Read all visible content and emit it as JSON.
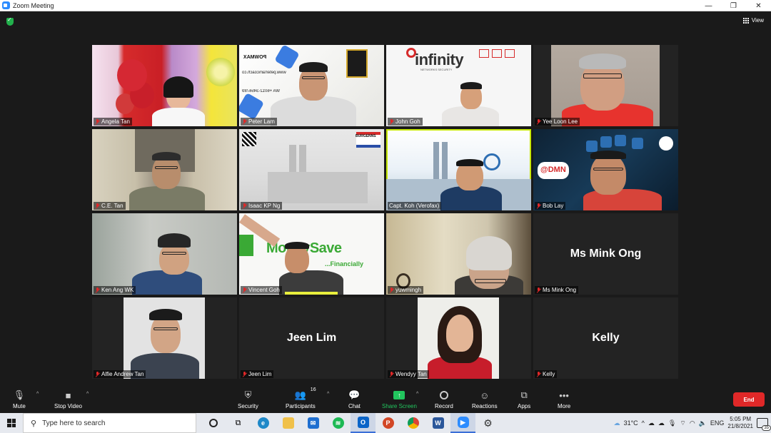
{
  "window": {
    "title": "Zoom Meeting",
    "minimize": "—",
    "maximize": "❐",
    "close": "✕"
  },
  "topbar": {
    "view_label": "View"
  },
  "tiles": [
    {
      "name": "Angela Tan"
    },
    {
      "name": "Peter Lam",
      "sign_lines": [
        "POWMAX",
        "www.peterlamcoach.co",
        "WA +6012-3456789"
      ]
    },
    {
      "name": "John Goh",
      "logo": "infinity",
      "logo_sub": "NETWORKS SECURITY"
    },
    {
      "name": "Yee Loon Lee"
    },
    {
      "name": "C.E. Tan"
    },
    {
      "name": "Isaac KP Ng",
      "brand": "BURGENNS"
    },
    {
      "name": "Capt. Koh (Verofax)"
    },
    {
      "name": "Bob Lay",
      "logo": "@DMN"
    },
    {
      "name": "Ken Ang WK"
    },
    {
      "name": "Vincent Goh",
      "banner": "MoneySave",
      "banner_sub": "...Financially"
    },
    {
      "name": "yuwmingh"
    },
    {
      "name": "Ms Mink Ong",
      "display": "Ms Mink Ong"
    },
    {
      "name": "Alfie Andrew Tan"
    },
    {
      "name": "Jeen Lim",
      "display": "Jeen Lim"
    },
    {
      "name": "Wendyy Tan"
    },
    {
      "name": "Kelly",
      "display": "Kelly"
    }
  ],
  "toolbar": {
    "mute": "Mute",
    "stop_video": "Stop Video",
    "security": "Security",
    "participants": "Participants",
    "participants_count": "16",
    "chat": "Chat",
    "share_screen": "Share Screen",
    "record": "Record",
    "reactions": "Reactions",
    "apps": "Apps",
    "more": "More",
    "end": "End"
  },
  "taskbar": {
    "search_placeholder": "Type here to search",
    "temperature": "31°C",
    "language": "ENG",
    "time": "5:05 PM",
    "date": "21/8/2021",
    "notifications": "35"
  },
  "colors": {
    "active_speaker": "#c7e800",
    "end_button": "#e02828",
    "share_green": "#22c55e"
  }
}
